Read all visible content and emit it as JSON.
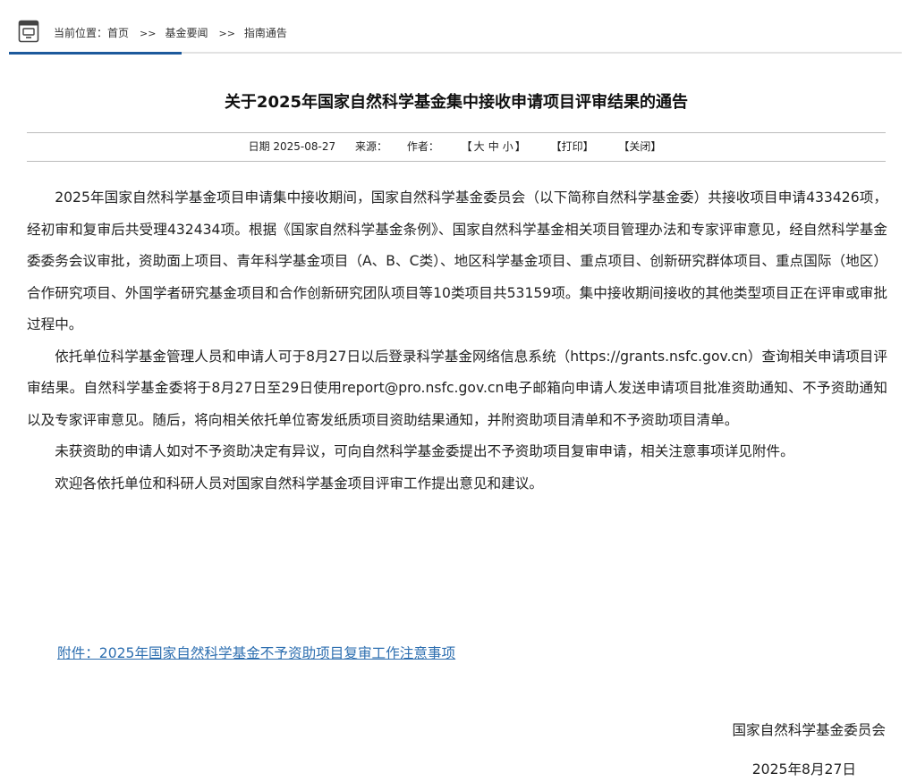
{
  "breadcrumb": {
    "prefix": "当前位置：",
    "items": [
      "首页",
      "基金要闻",
      "指南通告"
    ],
    "separator": ">>"
  },
  "article": {
    "title": "关于2025年国家自然科学基金集中接收申请项目评审结果的通告",
    "meta": {
      "date_label": "日期 2025-08-27",
      "source_label": "来源：",
      "author_label": "作者：",
      "font_size_open": "【",
      "font_size_options": [
        "大",
        "中",
        "小"
      ],
      "font_size_close": "】",
      "print_label": "【打印】",
      "close_label": "【关闭】"
    },
    "paragraphs": [
      "2025年国家自然科学基金项目申请集中接收期间，国家自然科学基金委员会（以下简称自然科学基金委）共接收项目申请433426项，经初审和复审后共受理432434项。根据《国家自然科学基金条例》、国家自然科学基金相关项目管理办法和专家评审意见，经自然科学基金委委务会议审批，资助面上项目、青年科学基金项目（A、B、C类）、地区科学基金项目、重点项目、创新研究群体项目、重点国际（地区）合作研究项目、外国学者研究基金项目和合作创新研究团队项目等10类项目共53159项。集中接收期间接收的其他类型项目正在评审或审批过程中。",
      "依托单位科学基金管理人员和申请人可于8月27日以后登录科学基金网络信息系统（https://grants.nsfc.gov.cn）查询相关申请项目评审结果。自然科学基金委将于8月27日至29日使用report@pro.nsfc.gov.cn电子邮箱向申请人发送申请项目批准资助通知、不予资助通知以及专家评审意见。随后，将向相关依托单位寄发纸质项目资助结果通知，并附资助项目清单和不予资助项目清单。",
      "未获资助的申请人如对不予资助决定有异议，可向自然科学基金委提出不予资助项目复审申请，相关注意事项详见附件。",
      "欢迎各依托单位和科研人员对国家自然科学基金项目评审工作提出意见和建议。"
    ],
    "attachment_link": "附件：2025年国家自然科学基金不予资助项目复审工作注意事项",
    "signature_org": "国家自然科学基金委员会",
    "signature_date": "2025年8月27日"
  },
  "colors": {
    "accent": "#1d5a9c",
    "link": "#2e6fb0"
  }
}
